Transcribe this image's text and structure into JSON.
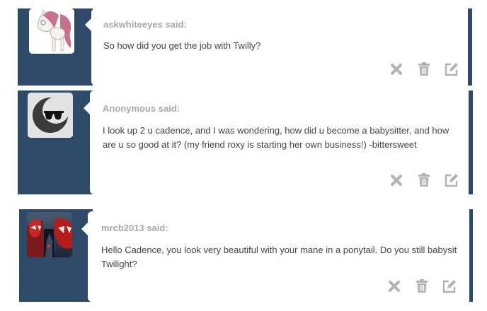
{
  "colors": {
    "panel": "#2e4a68",
    "bubble": "#ffffff",
    "asker": "#a8a8a8",
    "text": "#444444",
    "icon": "#b3b3b3"
  },
  "questions": [
    {
      "asker": "askwhiteeyes said:",
      "text": "So how did you get the job with Twilly?",
      "avatar": "pony-avatar",
      "actions": [
        "delete-icon",
        "trash-icon",
        "edit-icon"
      ]
    },
    {
      "asker": "Anonymous said:",
      "text": "I look up 2 u cadence, and I was wondering, how did u become a babysitter, and how are u so good at it? (my friend roxy is starting her own business!) -bittersweet",
      "avatar": "anonymous-sunglasses-avatar",
      "actions": [
        "delete-icon",
        "trash-icon",
        "edit-icon"
      ]
    },
    {
      "asker": "mrcb2013 said:",
      "text": "Hello Cadence, you look very beautiful with your mane in a ponytail. Do you still babysit Twilight?",
      "avatar": "spiderman-avatar",
      "actions": [
        "delete-icon",
        "trash-icon",
        "edit-icon"
      ]
    }
  ]
}
